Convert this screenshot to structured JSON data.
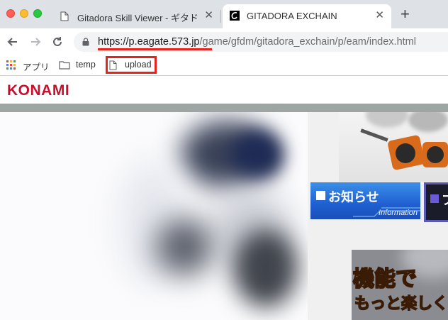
{
  "browser": {
    "tabs": [
      {
        "title": "Gitadora Skill Viewer - ギタドラ",
        "active": false
      },
      {
        "title": "GITADORA EXCHAIN",
        "active": true
      }
    ],
    "close_glyph": "✕",
    "new_tab_glyph": "+",
    "url_host": "https://p.eagate.573.jp",
    "url_path": "/game/gfdm/gitadora_exchain/p/eam/index.html"
  },
  "bookmarks": [
    {
      "label": "アプリ",
      "icon": "apps-grid-icon"
    },
    {
      "label": "temp",
      "icon": "folder-icon"
    },
    {
      "label": "upload",
      "icon": "page-icon"
    }
  ],
  "annotations": {
    "color": "#e8231b"
  },
  "page": {
    "logo": "KONAMI",
    "info_banner": {
      "title": "お知らせ",
      "subtitle": "Information"
    },
    "dark_banner_text": "プ",
    "promo": {
      "line1": "機能で",
      "line2": "もっと楽しく"
    }
  }
}
